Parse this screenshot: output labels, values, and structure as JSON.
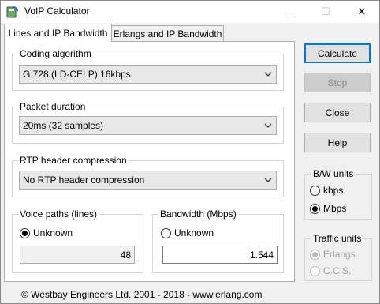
{
  "window": {
    "title": "VoIP Calculator",
    "controls": {
      "minimize": "—",
      "maximize": "☐",
      "close": "✕"
    }
  },
  "tabs": [
    {
      "label": "Lines and IP Bandwidth",
      "active": true
    },
    {
      "label": "Erlangs and IP Bandwidth",
      "active": false
    }
  ],
  "coding": {
    "label": "Coding algorithm",
    "value": "G.728 (LD-CELP) 16kbps"
  },
  "packet": {
    "label": "Packet duration",
    "value": "20ms (32 samples)"
  },
  "rtp": {
    "label": "RTP header compression",
    "value": "No RTP header compression"
  },
  "voice": {
    "label": "Voice paths (lines)",
    "radio_label": "Unknown",
    "checked": true,
    "value": "48"
  },
  "bandwidth": {
    "label": "Bandwidth (Mbps)",
    "radio_label": "Unknown",
    "checked": false,
    "value": "1.544"
  },
  "buttons": {
    "calculate": "Calculate",
    "stop": "Stop",
    "close": "Close",
    "help": "Help"
  },
  "bw_units": {
    "label": "B/W units",
    "options": [
      "kbps",
      "Mbps"
    ],
    "selected": "Mbps"
  },
  "traffic_units": {
    "label": "Traffic units",
    "options": [
      "Erlangs",
      "C.C.S."
    ],
    "selected": "Erlangs",
    "disabled": true
  },
  "footer": "© Westbay Engineers Ltd. 2001 - 2018  -  www.erlang.com",
  "colors": {
    "accent": "#0078d7",
    "window_bg": "#f0f0f0",
    "panel_bg": "#ffffff",
    "disabled_text": "#a0a0a0"
  },
  "icons": {
    "app": "telephone-calculator-icon",
    "dropdown": "chevron-down-icon"
  }
}
